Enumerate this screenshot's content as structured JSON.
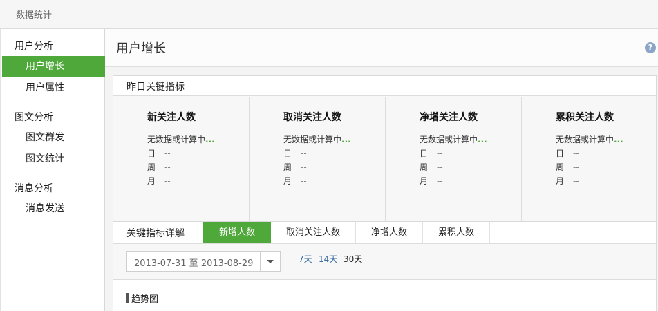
{
  "app": {
    "title": "数据统计"
  },
  "sidebar": {
    "groups": [
      {
        "label": "用户分析",
        "items": [
          {
            "label": "用户增长",
            "active": true
          },
          {
            "label": "用户属性",
            "active": false
          }
        ]
      },
      {
        "label": "图文分析",
        "items": [
          {
            "label": "图文群发",
            "active": false
          },
          {
            "label": "图文统计",
            "active": false
          }
        ]
      },
      {
        "label": "消息分析",
        "items": [
          {
            "label": "消息发送",
            "active": false
          }
        ]
      }
    ]
  },
  "page": {
    "title": "用户增长",
    "help_icon": "help-icon",
    "help_glyph": "?"
  },
  "key_metrics": {
    "title": "昨日关键指标",
    "metrics": [
      {
        "title": "新关注人数",
        "status": "无数据或计算中",
        "status_dots": "...",
        "day_label": "日",
        "day": "--",
        "week_label": "周",
        "week": "--",
        "month_label": "月",
        "month": "--"
      },
      {
        "title": "取消关注人数",
        "status": "无数据或计算中",
        "status_dots": "...",
        "day_label": "日",
        "day": "--",
        "week_label": "周",
        "week": "--",
        "month_label": "月",
        "month": "--"
      },
      {
        "title": "净增关注人数",
        "status": "无数据或计算中",
        "status_dots": "...",
        "day_label": "日",
        "day": "--",
        "week_label": "周",
        "week": "--",
        "month_label": "月",
        "month": "--"
      },
      {
        "title": "累积关注人数",
        "status": "无数据或计算中",
        "status_dots": "...",
        "day_label": "日",
        "day": "--",
        "week_label": "周",
        "week": "--",
        "month_label": "月",
        "month": "--"
      }
    ]
  },
  "detail": {
    "label": "关键指标详解",
    "tabs": [
      {
        "label": "新增人数",
        "active": true
      },
      {
        "label": "取消关注人数",
        "active": false
      },
      {
        "label": "净增人数",
        "active": false
      },
      {
        "label": "累积人数",
        "active": false
      }
    ],
    "date_range": {
      "value": "2013-07-31 至 2013-08-29"
    },
    "range_options": [
      {
        "label": "7天",
        "current": false
      },
      {
        "label": "14天",
        "current": false
      },
      {
        "label": "30天",
        "current": true
      }
    ],
    "trend_title": "趋势图"
  },
  "colors": {
    "accent": "#4ea83a",
    "link": "#3a6ea5"
  }
}
